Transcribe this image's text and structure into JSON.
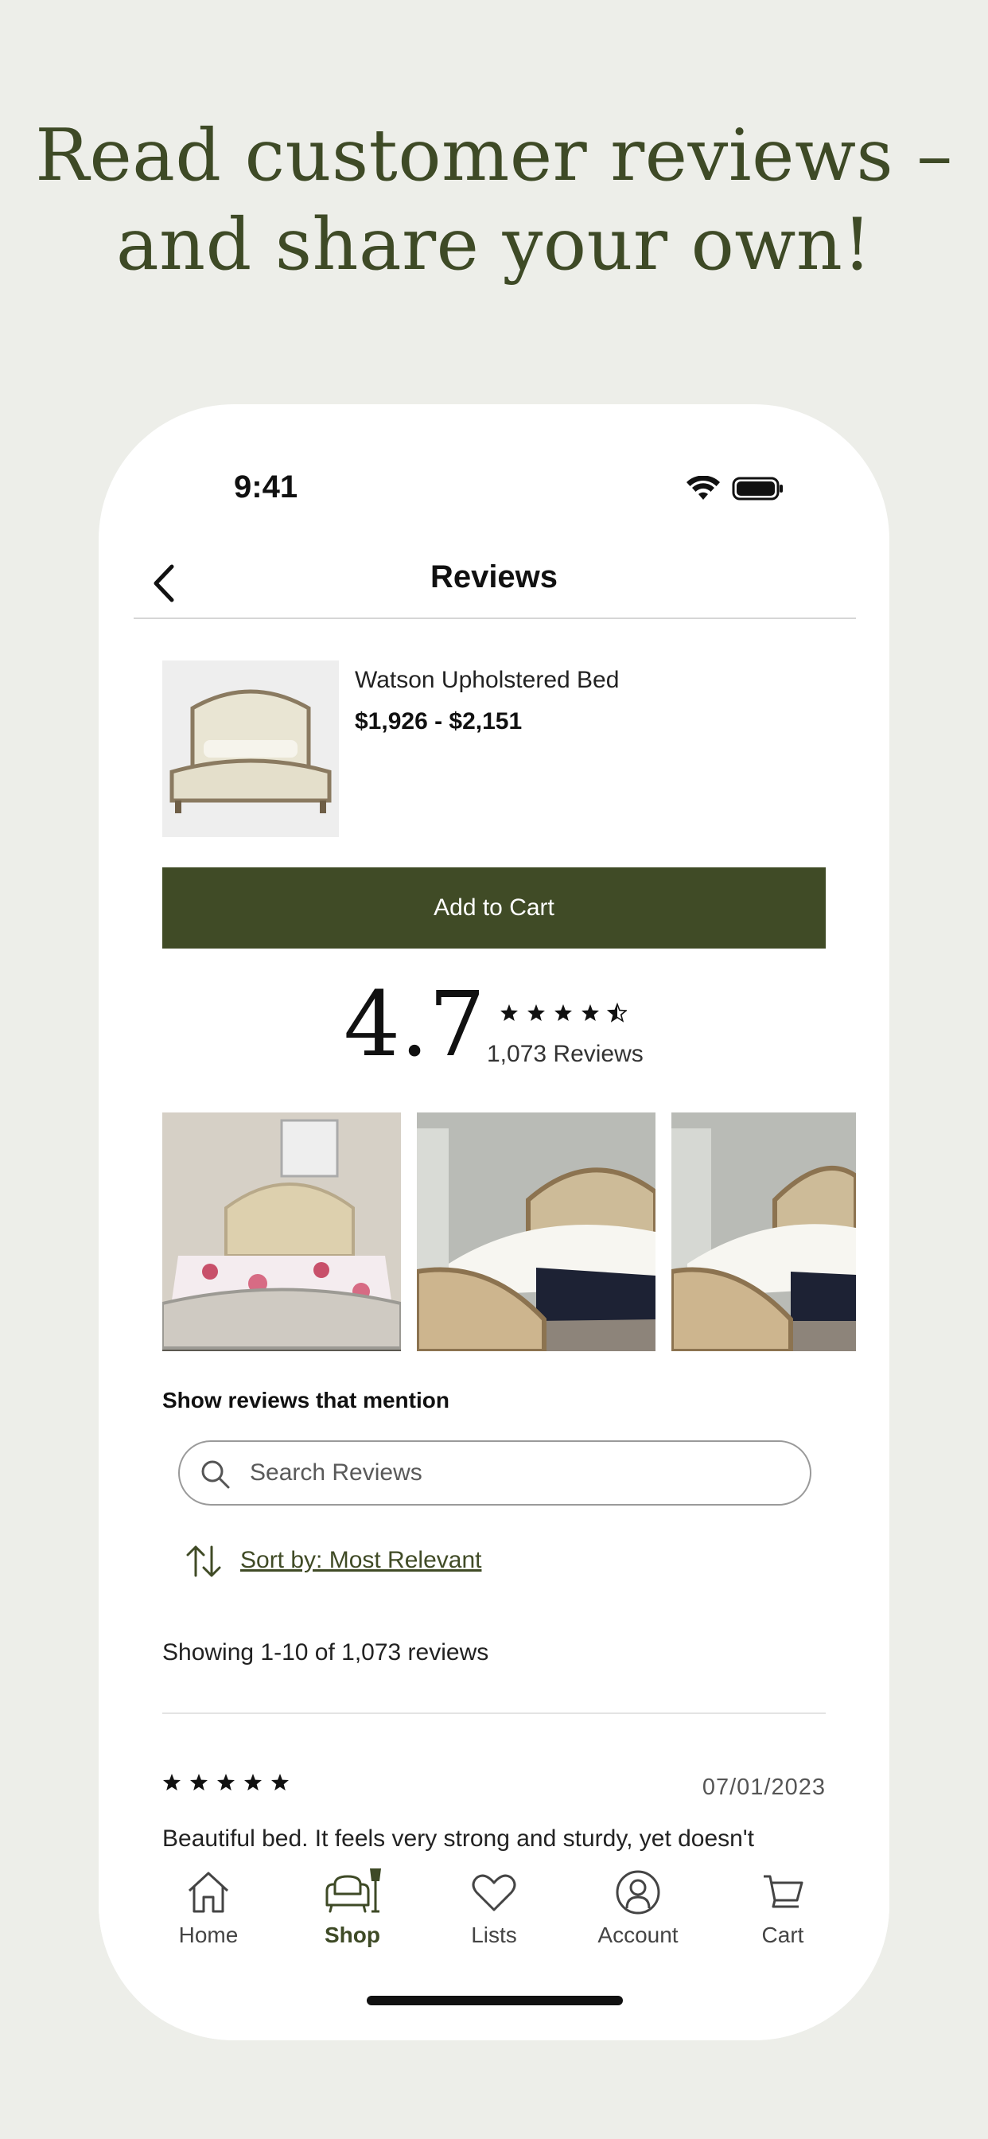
{
  "headline": {
    "line1": "Read customer reviews –",
    "line2": "and share your own!"
  },
  "status_bar": {
    "time": "9:41"
  },
  "nav": {
    "title": "Reviews"
  },
  "product": {
    "name": "Watson Upholstered Bed",
    "price": "$1,926 - $2,151",
    "add_to_cart_label": "Add to Cart"
  },
  "rating": {
    "average": "4.7",
    "stars": 4.5,
    "count_label": "1,073 Reviews"
  },
  "photos": [
    {
      "name": "review-photo-1"
    },
    {
      "name": "review-photo-2"
    },
    {
      "name": "review-photo-3"
    }
  ],
  "filter": {
    "mention_label": "Show reviews that mention",
    "search_placeholder": "Search Reviews",
    "sort_label": "Sort by: Most Relevant",
    "showing_text": "Showing 1-10 of 1,073 reviews"
  },
  "reviews": [
    {
      "stars": 5,
      "date": "07/01/2023",
      "body": "Beautiful bed. It feels very strong and sturdy, yet doesn't"
    }
  ],
  "tab_bar": {
    "items": [
      {
        "label": "Home",
        "icon": "home-icon",
        "active": false
      },
      {
        "label": "Shop",
        "icon": "shop-icon",
        "active": true
      },
      {
        "label": "Lists",
        "icon": "heart-icon",
        "active": false
      },
      {
        "label": "Account",
        "icon": "account-icon",
        "active": false
      },
      {
        "label": "Cart",
        "icon": "cart-icon",
        "active": false
      }
    ]
  },
  "colors": {
    "accent": "#404b26",
    "background": "#edeee9",
    "headline": "#3e4a26"
  }
}
